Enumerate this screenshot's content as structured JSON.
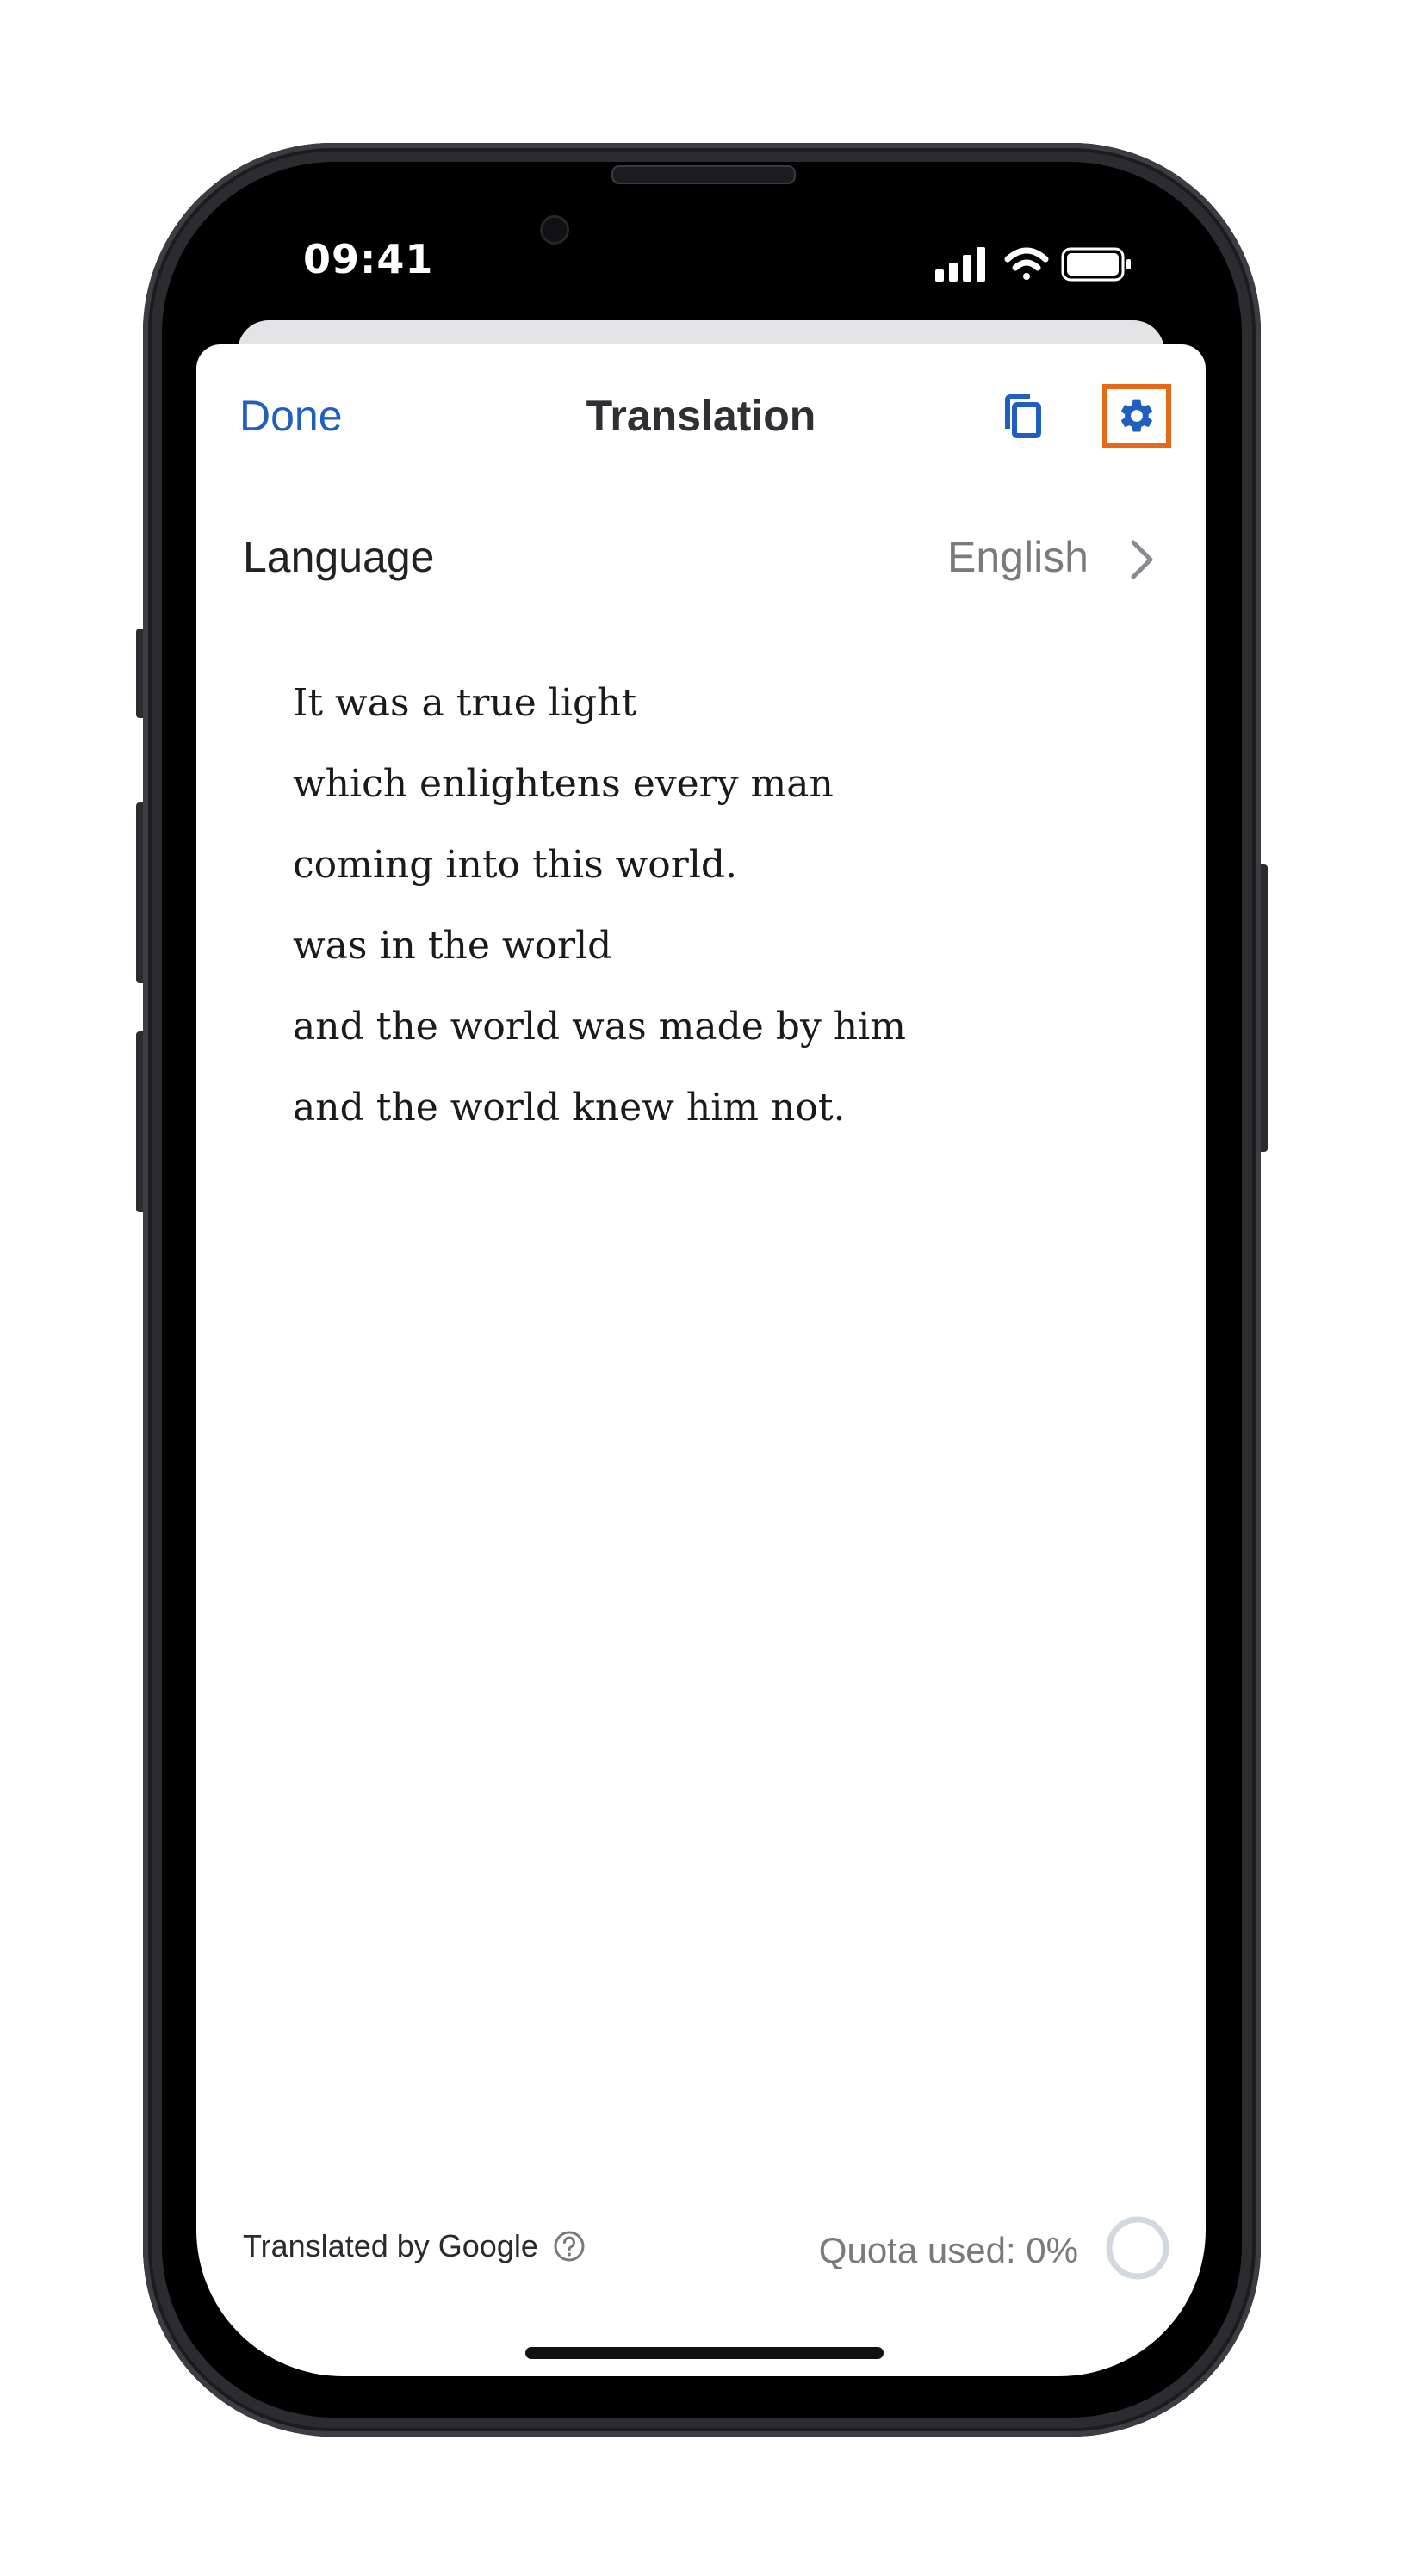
{
  "status_bar": {
    "time": "09:41",
    "icons": [
      "cellular-signal-icon",
      "wifi-icon",
      "battery-icon"
    ]
  },
  "nav": {
    "done_label": "Done",
    "title": "Translation",
    "copy_icon": "copy-icon",
    "settings_icon": "gear-icon"
  },
  "language": {
    "label": "Language",
    "value": "English"
  },
  "translation": {
    "lines": [
      "It was a true light",
      "which enlightens every man",
      "coming into this world.",
      "was in the world",
      "and the world was made by him",
      "and the world knew him not."
    ]
  },
  "footer": {
    "attribution": "Translated by Google",
    "quota_text": "Quota used: 0%",
    "quota_fraction": 0
  },
  "colors": {
    "accent": "#1f5fbf",
    "highlight": "#e8681a",
    "secondary_text": "#7a7a7e"
  }
}
